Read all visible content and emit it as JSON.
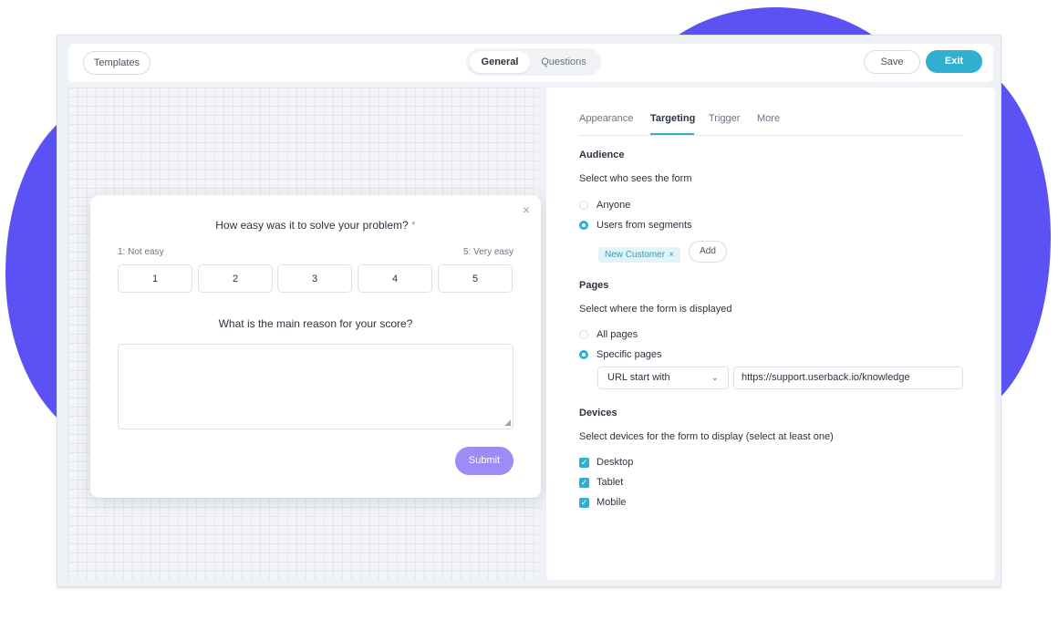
{
  "topbar": {
    "templates_label": "Templates",
    "segment": {
      "general": "General",
      "questions": "Questions"
    },
    "save_label": "Save",
    "exit_label": "Exit"
  },
  "form": {
    "close_glyph": "×",
    "question1": "How easy was it to solve your problem?",
    "required_mark": "*",
    "scale_low": "1: Not easy",
    "scale_high": "5: Very easy",
    "scale_options": [
      "1",
      "2",
      "3",
      "4",
      "5"
    ],
    "question2": "What is the main reason for your score?",
    "resize_glyph": "◢",
    "submit_label": "Submit"
  },
  "panel": {
    "tabs": [
      "Appearance",
      "Targeting",
      "Trigger",
      "More"
    ],
    "active_tab": "Targeting",
    "audience": {
      "title": "Audience",
      "subtitle": "Select who sees the form",
      "options": [
        "Anyone",
        "Users from segments"
      ],
      "selected": "Users from segments",
      "segment_chip": "New Customer",
      "chip_remove": "×",
      "add_label": "Add"
    },
    "pages": {
      "title": "Pages",
      "subtitle": "Select where the form is displayed",
      "options": [
        "All pages",
        "Specific pages"
      ],
      "selected": "Specific pages",
      "match_type": "URL start with",
      "url_value": "https://support.userback.io/knowledge"
    },
    "devices": {
      "title": "Devices",
      "subtitle": "Select devices for the form to display (select at least one)",
      "options": [
        "Desktop",
        "Tablet",
        "Mobile"
      ],
      "checked": [
        "Desktop",
        "Tablet",
        "Mobile"
      ]
    }
  },
  "icons": {
    "check": "✓",
    "chevron_down": "⌄"
  },
  "colors": {
    "accent": "#2fb0d0",
    "brand_blob": "#5a52f5",
    "submit": "#9b8cf7"
  }
}
